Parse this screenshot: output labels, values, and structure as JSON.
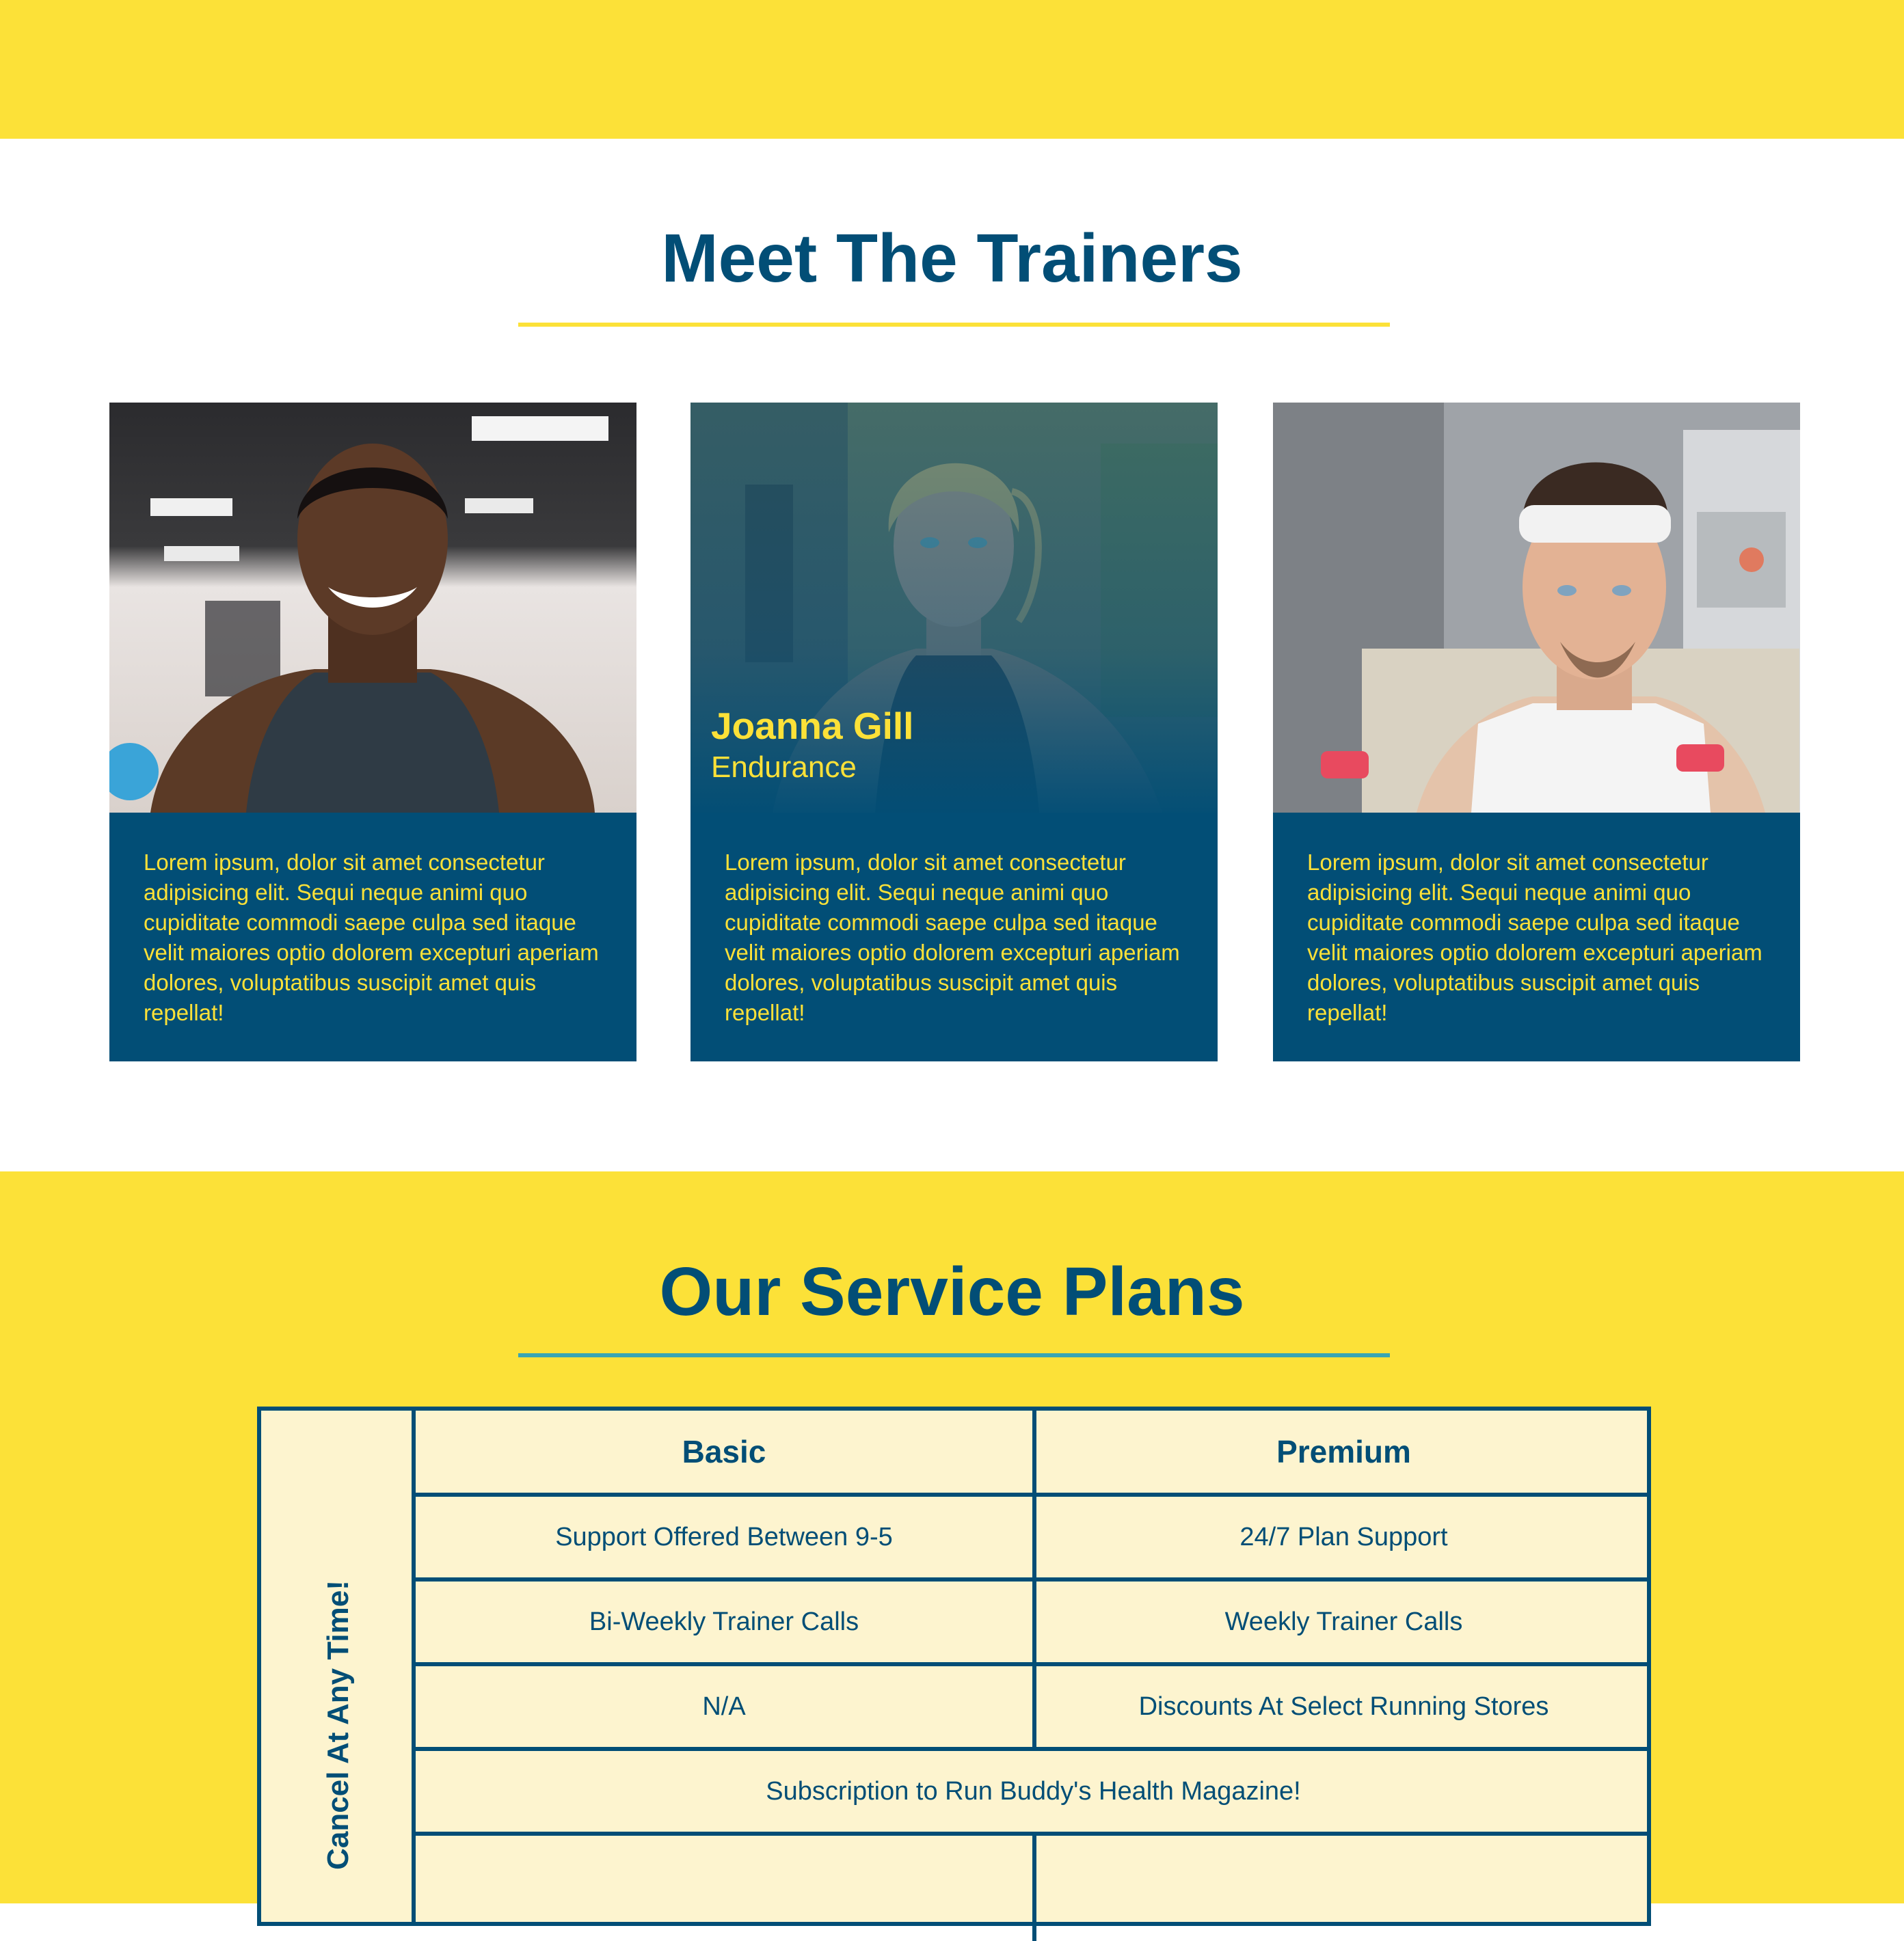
{
  "colors": {
    "primary_blue": "#024e76",
    "accent_yellow": "#fce138",
    "teal_rule": "#39a6b2",
    "table_cell_bg": "#fdf4cf"
  },
  "trainers": {
    "title": "Meet The Trainers",
    "cards": [
      {
        "name": "",
        "role": "",
        "bio": "Lorem ipsum, dolor sit amet consectetur adipisicing elit. Sequi neque animi quo cupiditate commodi saepe culpa sed itaque velit maiores optio dolorem excepturi aperiam dolores, voluptatibus suscipit amet quis repellat!"
      },
      {
        "name": "Joanna Gill",
        "role": "Endurance",
        "bio": "Lorem ipsum, dolor sit amet consectetur adipisicing elit. Sequi neque animi quo cupiditate commodi saepe culpa sed itaque velit maiores optio dolorem excepturi aperiam dolores, voluptatibus suscipit amet quis repellat!"
      },
      {
        "name": "",
        "role": "",
        "bio": "Lorem ipsum, dolor sit amet consectetur adipisicing elit. Sequi neque animi quo cupiditate commodi saepe culpa sed itaque velit maiores optio dolorem excepturi aperiam dolores, voluptatibus suscipit amet quis repellat!"
      }
    ]
  },
  "plans": {
    "title": "Our Service Plans",
    "side_label": "Cancel At Any Time!",
    "headers": [
      "Basic",
      "Premium"
    ],
    "rows": [
      [
        "Support Offered Between 9-5",
        "24/7 Plan Support"
      ],
      [
        "Bi-Weekly Trainer Calls",
        "Weekly Trainer Calls"
      ],
      [
        "N/A",
        "Discounts At Select Running Stores"
      ]
    ],
    "full_row": "Subscription to Run Buddy's Health Magazine!"
  }
}
